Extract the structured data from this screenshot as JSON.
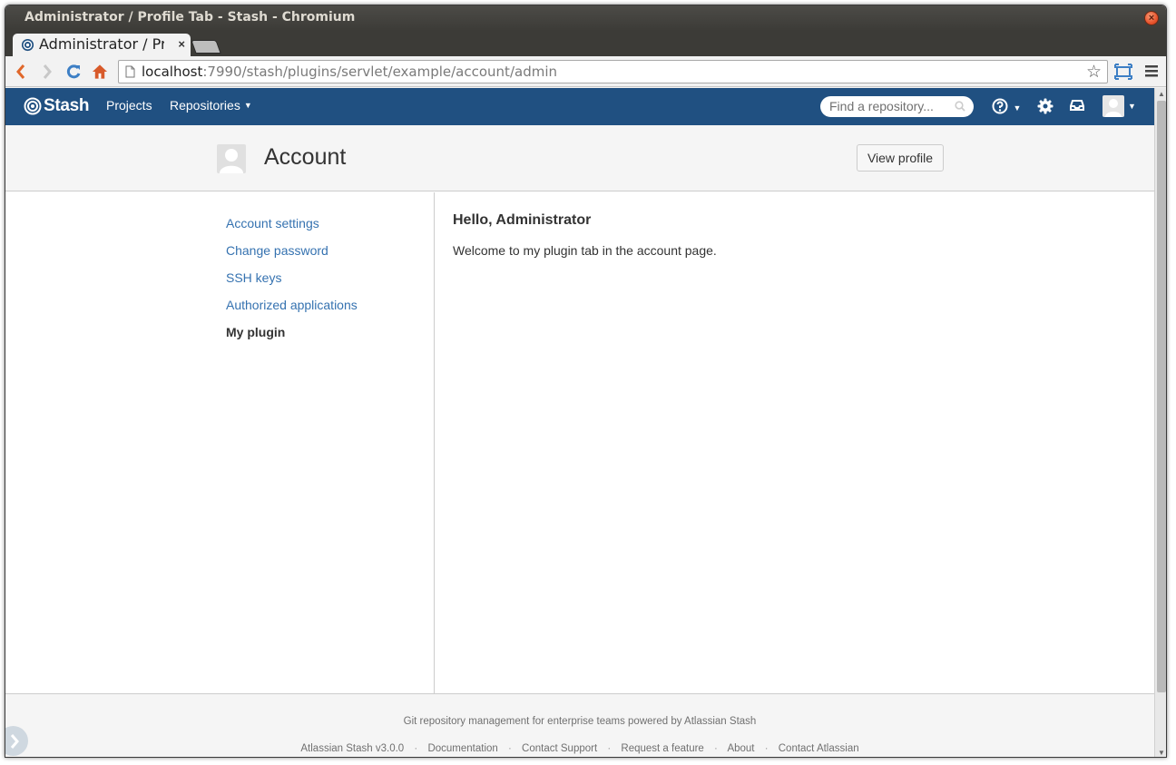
{
  "window": {
    "title": "Administrator / Profile Tab - Stash - Chromium"
  },
  "tab": {
    "title": "Administrator / Profile Tab - Stash",
    "close": "×"
  },
  "browser": {
    "url_host": "localhost",
    "url_rest": ":7990/stash/plugins/servlet/example/account/admin"
  },
  "header": {
    "logo": "Stash",
    "nav": {
      "projects": "Projects",
      "repositories": "Repositories"
    },
    "search_placeholder": "Find a repository...",
    "brand_color": "#205081"
  },
  "page": {
    "title": "Account",
    "view_profile": "View profile"
  },
  "sidebar": {
    "items": [
      {
        "label": "Account settings",
        "active": false
      },
      {
        "label": "Change password",
        "active": false
      },
      {
        "label": "SSH keys",
        "active": false
      },
      {
        "label": "Authorized applications",
        "active": false
      },
      {
        "label": "My plugin",
        "active": true
      }
    ]
  },
  "content": {
    "heading": "Hello, Administrator",
    "text": "Welcome to my plugin tab in the account page."
  },
  "footer": {
    "tagline": "Git repository management for enterprise teams powered by Atlassian Stash",
    "links": {
      "version": "Atlassian Stash v3.0.0",
      "documentation": "Documentation",
      "support": "Contact Support",
      "feature": "Request a feature",
      "about": "About",
      "contact": "Contact Atlassian"
    },
    "separator": "·"
  },
  "icons": {
    "back": "chevron-left-icon",
    "forward": "chevron-right-icon",
    "reload": "reload-icon",
    "home": "home-icon",
    "star": "star-icon",
    "help": "help-icon",
    "settings": "gear-icon",
    "inbox": "inbox-icon"
  }
}
